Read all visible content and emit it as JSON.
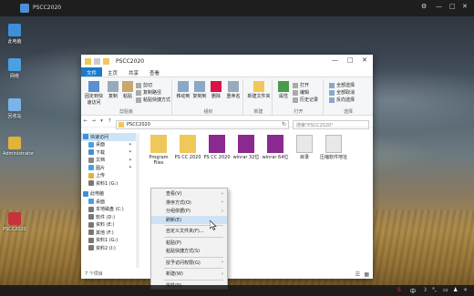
{
  "viewer": {
    "tab_title": "PSCC2020"
  },
  "desktop": {
    "icons": [
      {
        "label": "此电脑",
        "color": "#3f8fd8"
      },
      {
        "label": "网络",
        "color": "#4aa0e0"
      },
      {
        "label": "回收站",
        "color": "#7ab4e8"
      },
      {
        "label": "Administrator",
        "color": "#e2b33a"
      },
      {
        "label": "PSCC2020",
        "color": "#c8323a"
      }
    ]
  },
  "explorer": {
    "title": "PSCC2020",
    "tabs": [
      "文件",
      "主页",
      "共享",
      "查看"
    ],
    "ribbon": {
      "clipboard": {
        "label": "剪贴板",
        "pin": "固定到快速访问",
        "copy": "复制",
        "paste": "粘贴",
        "cut": "剪切",
        "copy_path": "复制路径",
        "paste_shortcut": "粘贴快捷方式"
      },
      "organize": {
        "label": "组织",
        "move_to": "移动到",
        "copy_to": "复制到",
        "delete": "删除",
        "rename": "重命名"
      },
      "new": {
        "label": "新建",
        "new_folder": "新建文件夹"
      },
      "open": {
        "label": "打开",
        "properties": "属性",
        "open": "打开",
        "edit": "编辑",
        "history": "历史记录"
      },
      "select": {
        "label": "选择",
        "select_all": "全部选择",
        "select_none": "全部取消",
        "invert": "反向选择"
      }
    },
    "address": {
      "path": "PSCC2020",
      "search_placeholder": "搜索\"PSCC2020\""
    },
    "sidebar": [
      {
        "label": "快速访问",
        "pinned": false,
        "highlight": true,
        "color": "#3f8fd8"
      },
      {
        "label": "桌面",
        "pinned": true,
        "color": "#4aa0e0"
      },
      {
        "label": "下载",
        "pinned": true,
        "color": "#3f8fd8"
      },
      {
        "label": "文档",
        "pinned": true,
        "color": "#888888"
      },
      {
        "label": "图片",
        "pinned": true,
        "color": "#4aa0e0"
      },
      {
        "label": "上传",
        "pinned": false,
        "color": "#e2b33a"
      },
      {
        "label": "资料1 (G:)",
        "pinned": false,
        "color": "#777777"
      },
      {
        "label": "此电脑",
        "pinned": false,
        "color": "#3f8fd8"
      },
      {
        "label": "桌面",
        "pinned": false,
        "color": "#4aa0e0"
      },
      {
        "label": "本地磁盘 (C:)",
        "pinned": false,
        "color": "#777777"
      },
      {
        "label": "软件 (D:)",
        "pinned": false,
        "color": "#777777"
      },
      {
        "label": "资料 (E:)",
        "pinned": false,
        "color": "#777777"
      },
      {
        "label": "其他 (F:)",
        "pinned": false,
        "color": "#777777"
      },
      {
        "label": "资料1 (G:)",
        "pinned": false,
        "color": "#777777"
      },
      {
        "label": "资料2 (I:)",
        "pinned": false,
        "color": "#777777"
      }
    ],
    "files": [
      {
        "name": "Program Files",
        "type": "folder"
      },
      {
        "name": "PS CC 2020",
        "type": "folder"
      },
      {
        "name": "PS CC 2020",
        "type": "rar"
      },
      {
        "name": "winrar 32位",
        "type": "rar"
      },
      {
        "name": "winrar 64位",
        "type": "rar"
      },
      {
        "name": "目录",
        "type": "doc"
      },
      {
        "name": "压缩软件地址",
        "type": "doc"
      }
    ],
    "status": "7 个项目"
  },
  "context_menu": {
    "items": [
      {
        "label": "查看(V)",
        "submenu": true
      },
      {
        "label": "排序方式(O)",
        "submenu": true
      },
      {
        "label": "分组依据(P)",
        "submenu": true
      },
      {
        "label": "刷新(E)",
        "highlight": true
      },
      {
        "sep": true
      },
      {
        "label": "自定义文件夹(F)..."
      },
      {
        "sep": true
      },
      {
        "label": "粘贴(P)"
      },
      {
        "label": "粘贴快捷方式(S)"
      },
      {
        "sep": true
      },
      {
        "label": "授予访问权限(G)",
        "submenu": true
      },
      {
        "sep": true
      },
      {
        "label": "新建(W)",
        "submenu": true
      },
      {
        "sep": true
      },
      {
        "label": "属性(R)"
      }
    ]
  },
  "colors": {
    "accent": "#1979ca",
    "folder": "#f0c75a",
    "rar": "#8b2a8e"
  }
}
